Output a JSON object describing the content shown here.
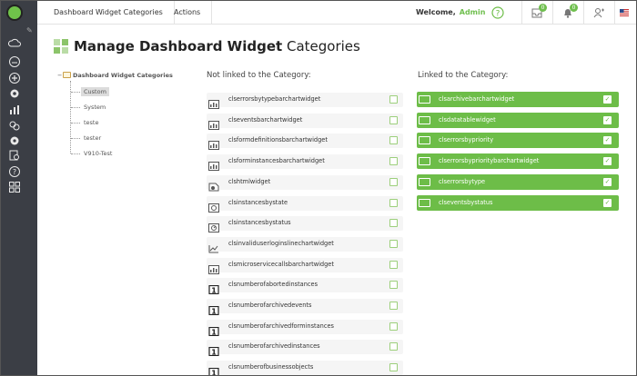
{
  "topbar": {
    "tabs": [
      "Dashboard Widget Categories",
      "Actions"
    ],
    "welcome": "Welcome,",
    "user": "Admin",
    "cart_badge": "0",
    "bell_badge": "0"
  },
  "page": {
    "title_bold": "Manage Dashboard Widget",
    "title_rest": " Categories"
  },
  "tree": {
    "root": "Dashboard Widget Categories",
    "items": [
      "Custom",
      "System",
      "teste",
      "tester",
      "V910-Test"
    ],
    "selected": "Custom"
  },
  "unlinked": {
    "heading": "Not linked to the Category:",
    "items": [
      {
        "label": "clserrorsbytypebarchartwidget",
        "icon": "chart-icon"
      },
      {
        "label": "clseventsbarchartwidget",
        "icon": "chart-icon"
      },
      {
        "label": "clsformdefinitionsbarchartwidget",
        "icon": "chart-icon"
      },
      {
        "label": "clsforminstancesbarchartwidget",
        "icon": "chart-icon"
      },
      {
        "label": "clshtmlwidget",
        "icon": "html-icon"
      },
      {
        "label": "clsinstancesbystate",
        "icon": "state-icon"
      },
      {
        "label": "clsinstancesbystatus",
        "icon": "status-icon"
      },
      {
        "label": "clsinvaliduserloginslinechartwidget",
        "icon": "line-chart-icon"
      },
      {
        "label": "clsmicroservicecallsbarchartwidget",
        "icon": "chart-icon"
      },
      {
        "label": "clsnumberofabortedinstances",
        "icon": "number-one-icon"
      },
      {
        "label": "clsnumberofarchivedevents",
        "icon": "number-one-icon"
      },
      {
        "label": "clsnumberofarchivedforminstances",
        "icon": "number-one-icon"
      },
      {
        "label": "clsnumberofarchivedinstances",
        "icon": "number-one-icon"
      },
      {
        "label": "clsnumberofbusinessobjects",
        "icon": "number-one-icon"
      }
    ]
  },
  "linked": {
    "heading": "Linked to the Category:",
    "items": [
      "clsarchivebarchartwidget",
      "clsdatatablewidget",
      "clserrorsbypriority",
      "clserrorsbyprioritybarchartwidget",
      "clserrorsbytype",
      "clseventsbystatus"
    ]
  },
  "colors": {
    "accent": "#6dbd48",
    "rail": "#3b3e45"
  }
}
